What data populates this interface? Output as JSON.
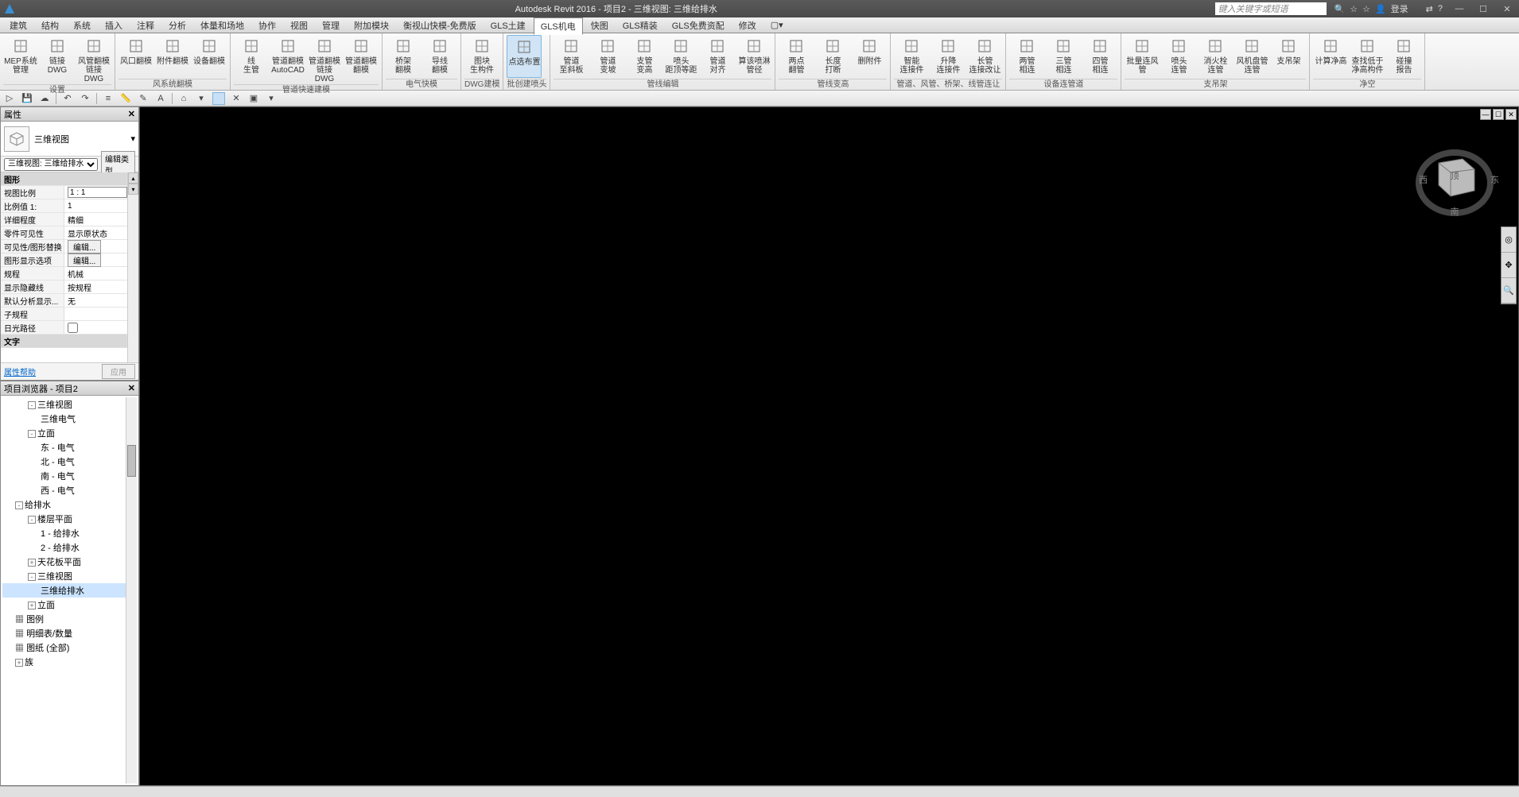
{
  "title": "Autodesk Revit 2016 -     项目2 - 三维视图: 三维给排水",
  "search_placeholder": "键入关键字或短语",
  "login_label": "登录",
  "menu": [
    "建筑",
    "结构",
    "系统",
    "插入",
    "注释",
    "分析",
    "体量和场地",
    "协作",
    "视图",
    "管理",
    "附加模块",
    "衡视山快模-免费版",
    "GLS土建",
    "GLS机电",
    "快图",
    "GLS精装",
    "GLS免费资配",
    "修改"
  ],
  "menu_active": 13,
  "ribbon_groups": [
    {
      "name": "设置",
      "btns": [
        {
          "l": "MEP系统\n管理"
        },
        {
          "l": "链接\nDWG"
        },
        {
          "l": "风管翻模\n链接DWG"
        }
      ]
    },
    {
      "name": "风系统翻模",
      "btns": [
        {
          "l": "风口翻模"
        },
        {
          "l": "附件翻模"
        },
        {
          "l": "设备翻模"
        }
      ]
    },
    {
      "name": "管道快速建模",
      "btns": [
        {
          "l": "线\n生管"
        },
        {
          "l": "管道翻模\nAutoCAD"
        },
        {
          "l": "管道翻模\n链接DWG"
        },
        {
          "l": "管道翻模\n翻模"
        }
      ]
    },
    {
      "name": "电气快模",
      "btns": [
        {
          "l": "桥架\n翻模"
        },
        {
          "l": "导线\n翻模"
        }
      ]
    },
    {
      "name": "DWG建模",
      "btns": [
        {
          "l": "图块\n生构件"
        }
      ]
    },
    {
      "name": "批创建喷头",
      "btns": [
        {
          "l": "点选布置",
          "sel": true
        }
      ]
    },
    {
      "name": "管线编辑",
      "btns": [
        {
          "l": "管道\n至斜板"
        },
        {
          "l": "管道\n变坡"
        },
        {
          "l": "支管\n变高"
        },
        {
          "l": "喷头\n距顶等距"
        },
        {
          "l": "管道\n对齐"
        },
        {
          "l": "算该喷淋\n管径"
        }
      ]
    },
    {
      "name": "管线变高",
      "btns": [
        {
          "l": "两点\n翻管"
        },
        {
          "l": "长度\n打断"
        },
        {
          "l": "删附件"
        }
      ]
    },
    {
      "name": "管道、风管、桥架、线管连让",
      "btns": [
        {
          "l": "智能\n连接件"
        },
        {
          "l": "升降\n连接件"
        },
        {
          "l": "长管\n连接改让"
        }
      ]
    },
    {
      "name": "设备连管道",
      "btns": [
        {
          "l": "两管\n相连"
        },
        {
          "l": "三管\n相连"
        },
        {
          "l": "四管\n相连"
        }
      ]
    },
    {
      "name": "支吊架",
      "btns": [
        {
          "l": "批量连风管"
        },
        {
          "l": "喷头\n连管"
        },
        {
          "l": "消火栓\n连管"
        },
        {
          "l": "风机盘管\n连管"
        },
        {
          "l": "支吊架"
        }
      ]
    },
    {
      "name": "净空",
      "btns": [
        {
          "l": "计算净高"
        },
        {
          "l": "查找低于\n净高构件"
        },
        {
          "l": "碰撞\n报告"
        }
      ]
    }
  ],
  "props_title": "属性",
  "type_name": "三维视图",
  "type_row": {
    "sel": "三维视图: 三维给排水",
    "btn": "编辑类型"
  },
  "pgroups": [
    {
      "h": "图形",
      "rows": [
        {
          "k": "视图比例",
          "v": "1 : 1",
          "input": true
        },
        {
          "k": "比例值 1:",
          "v": "1"
        },
        {
          "k": "详细程度",
          "v": "精细"
        },
        {
          "k": "零件可见性",
          "v": "显示原状态"
        },
        {
          "k": "可见性/图形替换",
          "v": "编辑...",
          "btn": true
        },
        {
          "k": "图形显示选项",
          "v": "编辑...",
          "btn": true
        },
        {
          "k": "规程",
          "v": "机械"
        },
        {
          "k": "显示隐藏线",
          "v": "按规程"
        },
        {
          "k": "默认分析显示...",
          "v": "无"
        },
        {
          "k": "子规程",
          "v": ""
        },
        {
          "k": "日光路径",
          "v": "",
          "chk": true
        }
      ]
    },
    {
      "h": "文字",
      "rows": []
    }
  ],
  "props_help": "属性帮助",
  "props_apply": "应用",
  "browser_title": "项目浏览器 - 项目2",
  "tree": [
    {
      "t": "三维视图",
      "l": 2,
      "exp": "-"
    },
    {
      "t": "三维电气",
      "l": 3
    },
    {
      "t": "立面",
      "l": 2,
      "exp": "-"
    },
    {
      "t": "东 - 电气",
      "l": 3
    },
    {
      "t": "北 - 电气",
      "l": 3
    },
    {
      "t": "南 - 电气",
      "l": 3
    },
    {
      "t": "西 - 电气",
      "l": 3
    },
    {
      "t": "给排水",
      "l": 1,
      "exp": "-"
    },
    {
      "t": "楼层平面",
      "l": 2,
      "exp": "-"
    },
    {
      "t": "1 - 给排水",
      "l": 3
    },
    {
      "t": "2 - 给排水",
      "l": 3
    },
    {
      "t": "天花板平面",
      "l": 2,
      "exp": "+"
    },
    {
      "t": "三维视图",
      "l": 2,
      "exp": "-"
    },
    {
      "t": "三维给排水",
      "l": 3,
      "sel": true
    },
    {
      "t": "立面",
      "l": 2,
      "exp": "+"
    },
    {
      "t": "图例",
      "l": 1,
      "ico": true
    },
    {
      "t": "明细表/数量",
      "l": 1,
      "ico": true
    },
    {
      "t": "图纸 (全部)",
      "l": 1,
      "ico": true
    },
    {
      "t": "族",
      "l": 1,
      "exp": "+"
    }
  ],
  "cube_labels": {
    "top": "顶",
    "s": "南",
    "e": "东",
    "w": "西"
  }
}
